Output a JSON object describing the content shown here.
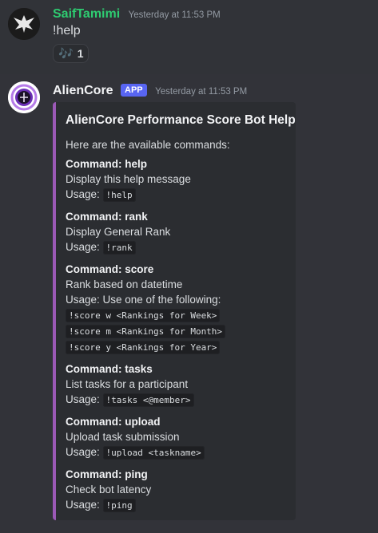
{
  "messages": [
    {
      "author": "SaifTamimi",
      "timestamp": "Yesterday at 11:53 PM",
      "content": "!help",
      "reaction": {
        "emoji": "🎶",
        "count": "1"
      }
    },
    {
      "author": "AlienCore",
      "badge": "APP",
      "timestamp": "Yesterday at 11:53 PM",
      "embed": {
        "title": "AlienCore Performance Score Bot Help",
        "intro": "Here are the available commands:",
        "fields": [
          {
            "name": "Command: help",
            "desc": "Display this help message",
            "usage_label": "Usage:",
            "usage_code": "!help"
          },
          {
            "name": "Command: rank",
            "desc": "Display General Rank",
            "usage_label": "Usage:",
            "usage_code": "!rank"
          },
          {
            "name": "Command: score",
            "desc": "Rank based on datetime",
            "usage_text": "Usage: Use one of the following:",
            "codes": [
              "!score w <Rankings for Week>",
              "!score m <Rankings for Month>",
              "!score y <Rankings for Year>"
            ]
          },
          {
            "name": "Command: tasks",
            "desc": "List tasks for a participant",
            "usage_label": "Usage:",
            "usage_code": "!tasks <@member>"
          },
          {
            "name": "Command: upload",
            "desc": "Upload task submission",
            "usage_label": "Usage:",
            "usage_code": "!upload <taskname>"
          },
          {
            "name": "Command: ping",
            "desc": "Check bot latency",
            "usage_label": "Usage:",
            "usage_code": "!ping"
          }
        ]
      }
    }
  ],
  "colors": {
    "background": "#313338",
    "embed_bar": "#9b59b6",
    "saif_name": "#2ecc71",
    "app_badge": "#5865f2"
  }
}
